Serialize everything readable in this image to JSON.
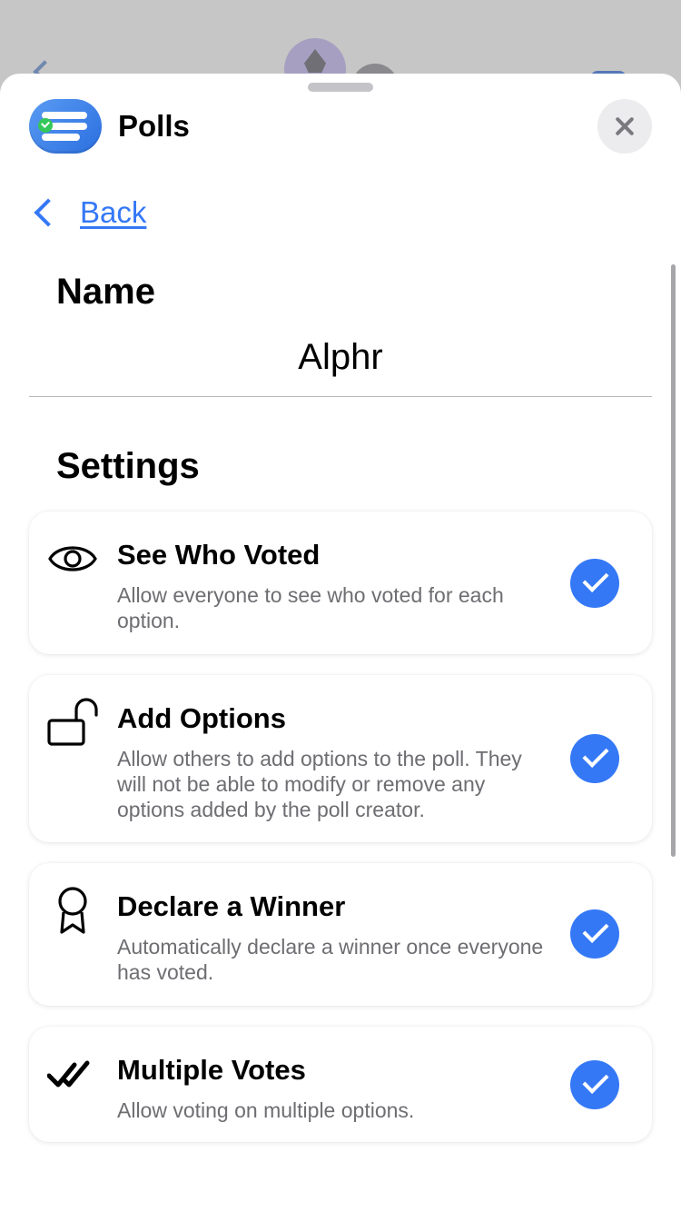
{
  "header": {
    "app_title": "Polls",
    "app_icon": "polls-list-icon",
    "close_icon": "close-icon"
  },
  "nav": {
    "back_label": "Back"
  },
  "name_section": {
    "heading": "Name",
    "value": "Alphr"
  },
  "settings_section": {
    "heading": "Settings",
    "items": [
      {
        "title": "See Who Voted",
        "description": "Allow everyone to see who voted for each option.",
        "icon": "eye-icon",
        "checked": true
      },
      {
        "title": "Add Options",
        "description": "Allow others to add options to the poll. They will not be able to modify or remove any options added by the poll creator.",
        "icon": "unlock-icon",
        "checked": true
      },
      {
        "title": "Declare a Winner",
        "description": "Automatically declare a winner once everyone has voted.",
        "icon": "award-ribbon-icon",
        "checked": true
      },
      {
        "title": "Multiple Votes",
        "description": "Allow voting on multiple options.",
        "icon": "double-check-icon",
        "checked": true
      }
    ]
  },
  "colors": {
    "accent": "#3478f6",
    "app_icon": "#3a82ec",
    "description_text": "#6d6d72"
  }
}
